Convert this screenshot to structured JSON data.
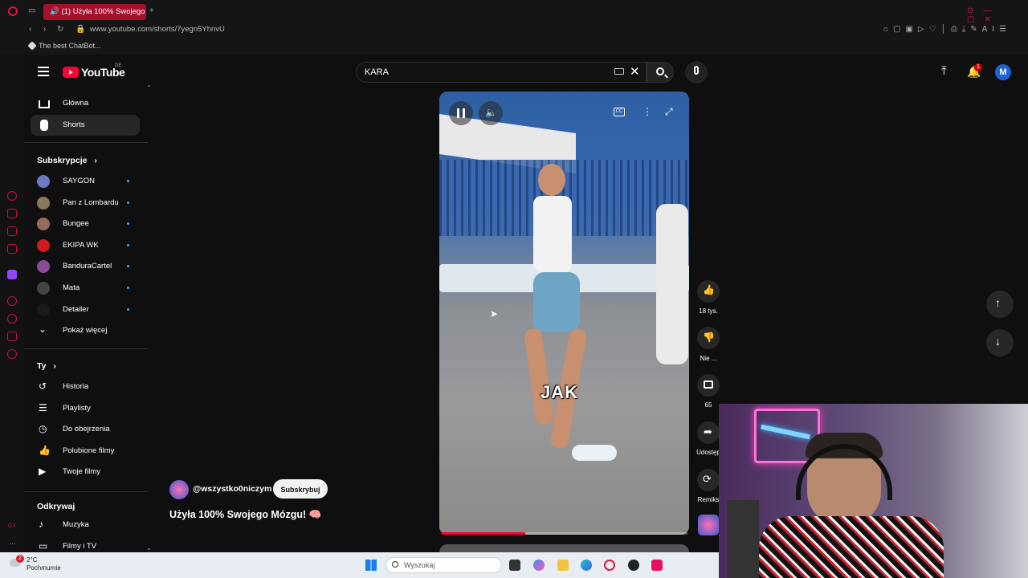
{
  "browser": {
    "tab_title": "(1) Użyła 100% Swojego",
    "url": "www.youtube.com/shorts/7yegn5YhnvU",
    "bookmark": "The best ChatBot..."
  },
  "header": {
    "logo_text": "YouTube",
    "region": "DE",
    "search_value": "KARA",
    "avatar_letter": "M",
    "notification_count": "1"
  },
  "sidebar": {
    "main": [
      {
        "label": "Główna",
        "icon": "home-icon"
      },
      {
        "label": "Shorts",
        "icon": "shorts-icon"
      }
    ],
    "subscriptions_title": "Subskrypcje",
    "subscriptions": [
      {
        "label": "SAYGON",
        "color": "#6a7ac0"
      },
      {
        "label": "Pan z Lombardu",
        "color": "#8a7a5a"
      },
      {
        "label": "Bungee",
        "color": "#9a6a5a"
      },
      {
        "label": "EKIPA WK",
        "color": "#d01a20"
      },
      {
        "label": "BanduraCartel",
        "color": "#8a4a9a"
      },
      {
        "label": "Mata",
        "color": "#444444"
      },
      {
        "label": "Detailer",
        "color": "#1a1a1a"
      }
    ],
    "show_more": "Pokaż więcej",
    "you_title": "Ty",
    "you": [
      {
        "label": "Historia",
        "icon": "history-icon"
      },
      {
        "label": "Playlisty",
        "icon": "playlist-icon"
      },
      {
        "label": "Do obejrzenia",
        "icon": "clock-icon"
      },
      {
        "label": "Polubione filmy",
        "icon": "like-icon"
      },
      {
        "label": "Twoje filmy",
        "icon": "video-icon"
      }
    ],
    "explore_title": "Odkrywaj",
    "explore": [
      {
        "label": "Muzyka",
        "icon": "music-icon"
      },
      {
        "label": "Filmy i TV",
        "icon": "film-icon"
      }
    ]
  },
  "video": {
    "caption": "JAK",
    "channel": "@wszystko0niczym",
    "subscribe": "Subskrybuj",
    "title": "Użyła 100% Swojego Mózgu! 🧠",
    "progress": 0.34,
    "likes": "18 tys.",
    "dislike": "Nie ...",
    "comments": "65",
    "share": "Udostęp",
    "remix": "Remiks"
  },
  "taskbar": {
    "weather_temp": "2°C",
    "weather_desc": "Pochmurnie",
    "weather_badge": "2",
    "search_placeholder": "Wyszukaj"
  }
}
